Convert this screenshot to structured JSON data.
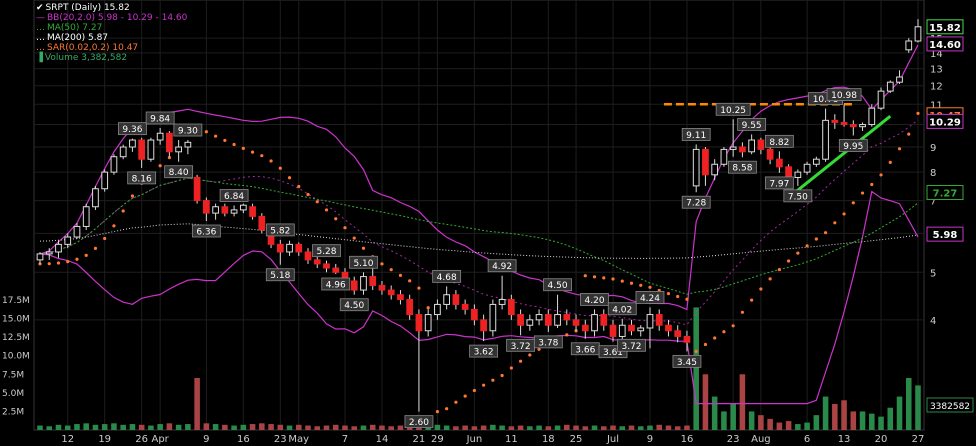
{
  "legend": [
    {
      "text": "SRPT (Daily) 15.82",
      "color": "#ffffff",
      "marker": "check-icon"
    },
    {
      "text": "BB(20,2.0) 5.98 - 10.29 - 14.60",
      "color": "#cc33cc",
      "marker": "line"
    },
    {
      "text": "MA(50) 7.27",
      "color": "#33aa33",
      "marker": "dots"
    },
    {
      "text": "MA(200) 5.87",
      "color": "#ffffff",
      "marker": "dots"
    },
    {
      "text": "SAR(0.02,0.2) 10.47",
      "color": "#ff7733",
      "marker": "dots"
    },
    {
      "text": "Volume 3,382,582",
      "color": "#33aa66",
      "marker": "bars-icon"
    }
  ],
  "colors": {
    "background": "#000000",
    "up": "#44dd44",
    "down": "#ee2222",
    "bollinger": "#cc33cc",
    "ma50": "#33aa33",
    "ma200": "#dddddd",
    "sar": "#ff7733",
    "resistance": "#ff8800",
    "trendline": "#33dd33",
    "volume": "#2a8a4a",
    "volume_down": "#aa4444",
    "grid": "#1e1e1e",
    "tag_bg": "#333333",
    "tag_border": "#888888",
    "tag_text": "#ffffff"
  },
  "chart_data": {
    "type": "candlestick",
    "ticker": "SRPT",
    "period": "Daily",
    "last_price": "15.82",
    "bb_upper_tag": "14.60",
    "bb_mid_tag": "10.29",
    "sar_tag": "10.47",
    "ma50_tag": "7.27",
    "ma200_tag": "5.98",
    "volume_tag": "3382582",
    "y_ticks": [
      4,
      5,
      6,
      7,
      8,
      9,
      10,
      11,
      12,
      13,
      14,
      15
    ],
    "volume_ticks": [
      "2.5M",
      "5.0M",
      "7.5M",
      "10.0M",
      "12.5M",
      "15.0M",
      "17.5M"
    ],
    "x_ticks": [
      "12",
      "19",
      "26",
      "Apr",
      "9",
      "16",
      "23",
      "May",
      "7",
      "14",
      "21",
      "29",
      "Jun",
      "11",
      "18",
      "25",
      "Jul",
      "9",
      "16",
      "23",
      "Aug",
      "6",
      "13",
      "20",
      "27"
    ],
    "candles": [
      {
        "o": 5.3,
        "h": 5.5,
        "l": 5.2,
        "c": 5.45
      },
      {
        "o": 5.45,
        "h": 5.6,
        "l": 5.3,
        "c": 5.5
      },
      {
        "o": 5.5,
        "h": 5.8,
        "l": 5.35,
        "c": 5.7
      },
      {
        "o": 5.7,
        "h": 6.0,
        "l": 5.6,
        "c": 5.9
      },
      {
        "o": 5.9,
        "h": 6.3,
        "l": 5.85,
        "c": 6.2
      },
      {
        "o": 6.2,
        "h": 6.9,
        "l": 6.1,
        "c": 6.8
      },
      {
        "o": 6.8,
        "h": 7.5,
        "l": 6.7,
        "c": 7.4
      },
      {
        "o": 7.4,
        "h": 8.1,
        "l": 7.3,
        "c": 8.0
      },
      {
        "o": 8.0,
        "h": 8.7,
        "l": 7.9,
        "c": 8.6
      },
      {
        "o": 8.6,
        "h": 9.1,
        "l": 8.5,
        "c": 9.0
      },
      {
        "o": 9.0,
        "h": 9.36,
        "l": 8.8,
        "c": 9.3
      },
      {
        "o": 9.3,
        "h": 9.4,
        "l": 8.16,
        "c": 8.5
      },
      {
        "o": 8.5,
        "h": 9.4,
        "l": 8.4,
        "c": 9.3
      },
      {
        "o": 9.3,
        "h": 9.84,
        "l": 9.1,
        "c": 9.6
      },
      {
        "o": 9.6,
        "h": 9.7,
        "l": 8.6,
        "c": 8.8
      },
      {
        "o": 8.8,
        "h": 9.3,
        "l": 8.4,
        "c": 9.0
      },
      {
        "o": 9.0,
        "h": 9.3,
        "l": 8.7,
        "c": 9.2
      },
      {
        "o": 7.8,
        "h": 7.9,
        "l": 6.9,
        "c": 7.0
      },
      {
        "o": 7.0,
        "h": 7.1,
        "l": 6.36,
        "c": 6.6
      },
      {
        "o": 6.6,
        "h": 6.9,
        "l": 6.4,
        "c": 6.8
      },
      {
        "o": 6.8,
        "h": 6.9,
        "l": 6.5,
        "c": 6.6
      },
      {
        "o": 6.6,
        "h": 6.84,
        "l": 6.5,
        "c": 6.7
      },
      {
        "o": 6.7,
        "h": 6.9,
        "l": 6.6,
        "c": 6.85
      },
      {
        "o": 6.8,
        "h": 6.9,
        "l": 6.4,
        "c": 6.5
      },
      {
        "o": 6.5,
        "h": 6.6,
        "l": 6.0,
        "c": 6.1
      },
      {
        "o": 6.1,
        "h": 6.2,
        "l": 5.6,
        "c": 5.7
      },
      {
        "o": 5.7,
        "h": 5.82,
        "l": 5.18,
        "c": 5.5
      },
      {
        "o": 5.5,
        "h": 5.8,
        "l": 5.4,
        "c": 5.7
      },
      {
        "o": 5.7,
        "h": 5.75,
        "l": 5.4,
        "c": 5.5
      },
      {
        "o": 5.5,
        "h": 5.6,
        "l": 5.2,
        "c": 5.3
      },
      {
        "o": 5.3,
        "h": 5.4,
        "l": 5.1,
        "c": 5.2
      },
      {
        "o": 5.2,
        "h": 5.28,
        "l": 5.0,
        "c": 5.1
      },
      {
        "o": 5.1,
        "h": 5.2,
        "l": 4.96,
        "c": 5.0
      },
      {
        "o": 5.0,
        "h": 5.1,
        "l": 4.7,
        "c": 4.8
      },
      {
        "o": 4.8,
        "h": 4.9,
        "l": 4.5,
        "c": 4.6
      },
      {
        "o": 4.6,
        "h": 5.0,
        "l": 4.5,
        "c": 4.9
      },
      {
        "o": 4.9,
        "h": 5.1,
        "l": 4.6,
        "c": 4.7
      },
      {
        "o": 4.7,
        "h": 4.8,
        "l": 4.5,
        "c": 4.6
      },
      {
        "o": 4.6,
        "h": 4.7,
        "l": 4.4,
        "c": 4.5
      },
      {
        "o": 4.5,
        "h": 4.6,
        "l": 4.3,
        "c": 4.4
      },
      {
        "o": 4.4,
        "h": 4.5,
        "l": 4.0,
        "c": 4.1
      },
      {
        "o": 4.1,
        "h": 4.2,
        "l": 2.6,
        "c": 3.8
      },
      {
        "o": 3.8,
        "h": 4.2,
        "l": 3.7,
        "c": 4.1
      },
      {
        "o": 4.1,
        "h": 4.4,
        "l": 4.0,
        "c": 4.3
      },
      {
        "o": 4.3,
        "h": 4.68,
        "l": 4.2,
        "c": 4.5
      },
      {
        "o": 4.5,
        "h": 4.6,
        "l": 4.2,
        "c": 4.3
      },
      {
        "o": 4.3,
        "h": 4.4,
        "l": 4.1,
        "c": 4.2
      },
      {
        "o": 4.2,
        "h": 4.3,
        "l": 3.9,
        "c": 4.0
      },
      {
        "o": 4.0,
        "h": 4.1,
        "l": 3.62,
        "c": 3.8
      },
      {
        "o": 3.8,
        "h": 4.4,
        "l": 3.7,
        "c": 4.3
      },
      {
        "o": 4.3,
        "h": 4.92,
        "l": 4.2,
        "c": 4.4
      },
      {
        "o": 4.4,
        "h": 4.5,
        "l": 4.0,
        "c": 4.1
      },
      {
        "o": 4.1,
        "h": 4.2,
        "l": 3.72,
        "c": 3.9
      },
      {
        "o": 3.9,
        "h": 4.1,
        "l": 3.8,
        "c": 4.0
      },
      {
        "o": 4.0,
        "h": 4.2,
        "l": 3.9,
        "c": 4.1
      },
      {
        "o": 4.1,
        "h": 4.2,
        "l": 3.78,
        "c": 3.9
      },
      {
        "o": 3.9,
        "h": 4.5,
        "l": 3.85,
        "c": 4.1
      },
      {
        "o": 4.1,
        "h": 4.2,
        "l": 3.9,
        "c": 4.0
      },
      {
        "o": 4.0,
        "h": 4.1,
        "l": 3.8,
        "c": 3.9
      },
      {
        "o": 3.9,
        "h": 4.0,
        "l": 3.66,
        "c": 3.8
      },
      {
        "o": 3.8,
        "h": 4.2,
        "l": 3.7,
        "c": 4.1
      },
      {
        "o": 4.1,
        "h": 4.2,
        "l": 3.8,
        "c": 3.9
      },
      {
        "o": 3.9,
        "h": 4.0,
        "l": 3.61,
        "c": 3.7
      },
      {
        "o": 3.7,
        "h": 4.02,
        "l": 3.65,
        "c": 3.9
      },
      {
        "o": 3.9,
        "h": 4.0,
        "l": 3.72,
        "c": 3.8
      },
      {
        "o": 3.8,
        "h": 3.9,
        "l": 3.7,
        "c": 3.85
      },
      {
        "o": 3.85,
        "h": 4.24,
        "l": 3.5,
        "c": 4.1
      },
      {
        "o": 4.1,
        "h": 4.2,
        "l": 3.8,
        "c": 3.9
      },
      {
        "o": 3.9,
        "h": 4.0,
        "l": 3.7,
        "c": 3.8
      },
      {
        "o": 3.8,
        "h": 3.9,
        "l": 3.6,
        "c": 3.7
      },
      {
        "o": 3.7,
        "h": 3.8,
        "l": 3.45,
        "c": 3.6
      },
      {
        "o": 7.5,
        "h": 9.11,
        "l": 7.28,
        "c": 8.9
      },
      {
        "o": 8.9,
        "h": 9.0,
        "l": 7.5,
        "c": 7.9
      },
      {
        "o": 7.9,
        "h": 8.5,
        "l": 7.7,
        "c": 8.3
      },
      {
        "o": 8.3,
        "h": 9.0,
        "l": 8.2,
        "c": 8.9
      },
      {
        "o": 8.9,
        "h": 10.25,
        "l": 8.6,
        "c": 9.0
      },
      {
        "o": 9.0,
        "h": 9.2,
        "l": 8.58,
        "c": 8.8
      },
      {
        "o": 8.8,
        "h": 9.55,
        "l": 8.7,
        "c": 9.3
      },
      {
        "o": 9.3,
        "h": 9.4,
        "l": 8.7,
        "c": 8.9
      },
      {
        "o": 8.9,
        "h": 9.0,
        "l": 8.3,
        "c": 8.5
      },
      {
        "o": 8.5,
        "h": 8.82,
        "l": 7.97,
        "c": 8.2
      },
      {
        "o": 8.2,
        "h": 8.3,
        "l": 7.6,
        "c": 7.8
      },
      {
        "o": 7.8,
        "h": 8.1,
        "l": 7.5,
        "c": 8.0
      },
      {
        "o": 8.0,
        "h": 8.4,
        "l": 7.9,
        "c": 8.3
      },
      {
        "o": 8.3,
        "h": 8.6,
        "l": 8.2,
        "c": 8.5
      },
      {
        "o": 8.5,
        "h": 10.78,
        "l": 8.4,
        "c": 10.2
      },
      {
        "o": 10.2,
        "h": 10.5,
        "l": 9.8,
        "c": 10.1
      },
      {
        "o": 10.1,
        "h": 10.98,
        "l": 9.9,
        "c": 10.0
      },
      {
        "o": 10.0,
        "h": 10.2,
        "l": 9.5,
        "c": 9.9
      },
      {
        "o": 9.9,
        "h": 10.1,
        "l": 9.7,
        "c": 10.0
      },
      {
        "o": 10.0,
        "h": 11.0,
        "l": 9.9,
        "c": 10.8
      },
      {
        "o": 10.8,
        "h": 11.9,
        "l": 10.7,
        "c": 11.7
      },
      {
        "o": 11.7,
        "h": 12.3,
        "l": 11.6,
        "c": 12.2
      },
      {
        "o": 12.2,
        "h": 12.9,
        "l": 12.1,
        "c": 12.5
      },
      {
        "o": 14.2,
        "h": 15.0,
        "l": 14.0,
        "c": 14.8
      },
      {
        "o": 14.8,
        "h": 16.4,
        "l": 14.7,
        "c": 15.82
      }
    ],
    "volume_m": [
      0.6,
      0.5,
      0.7,
      0.6,
      0.8,
      0.9,
      0.7,
      0.8,
      0.9,
      0.7,
      0.8,
      0.7,
      0.6,
      0.8,
      0.9,
      0.7,
      0.8,
      7.0,
      0.9,
      0.8,
      0.7,
      0.6,
      0.7,
      0.8,
      0.9,
      0.8,
      0.7,
      0.6,
      0.7,
      0.6,
      0.5,
      0.6,
      0.7,
      0.6,
      0.5,
      0.6,
      0.7,
      0.6,
      0.5,
      0.6,
      0.7,
      0.9,
      0.8,
      0.7,
      0.6,
      0.5,
      0.6,
      0.5,
      0.6,
      0.7,
      0.6,
      0.5,
      0.6,
      0.5,
      0.6,
      0.5,
      0.6,
      0.7,
      0.6,
      0.5,
      0.6,
      0.5,
      0.6,
      0.5,
      0.6,
      0.5,
      0.6,
      0.7,
      0.6,
      0.5,
      0.6,
      16.5,
      7.5,
      4.5,
      2.5,
      3.5,
      7.5,
      2.5,
      2.0,
      1.5,
      1.0,
      1.2,
      0.8,
      1.0,
      2.0,
      4.5,
      3.5,
      4.0,
      2.5,
      2.5,
      2.2,
      1.8,
      3.0,
      4.5,
      7.0,
      6.0
    ],
    "labels_high": [
      {
        "i": 10,
        "v": "9.36"
      },
      {
        "i": 13,
        "v": "9.84"
      },
      {
        "i": 16,
        "v": "9.30"
      },
      {
        "i": 21,
        "v": "6.84"
      },
      {
        "i": 26,
        "v": "5.82"
      },
      {
        "i": 31,
        "v": "5.28"
      },
      {
        "i": 35,
        "v": "5.10"
      },
      {
        "i": 44,
        "v": "4.68"
      },
      {
        "i": 50,
        "v": "4.92"
      },
      {
        "i": 56,
        "v": "4.50"
      },
      {
        "i": 60,
        "v": "4.20"
      },
      {
        "i": 63,
        "v": "4.02"
      },
      {
        "i": 66,
        "v": "4.24"
      },
      {
        "i": 71,
        "v": "9.11"
      },
      {
        "i": 75,
        "v": "10.25"
      },
      {
        "i": 77,
        "v": "9.55"
      },
      {
        "i": 80,
        "v": "8.82"
      },
      {
        "i": 85,
        "v": "10.78"
      },
      {
        "i": 87,
        "v": "10.98"
      }
    ],
    "labels_low": [
      {
        "i": 11,
        "v": "8.16"
      },
      {
        "i": 15,
        "v": "8.40"
      },
      {
        "i": 18,
        "v": "6.36"
      },
      {
        "i": 26,
        "v": "5.18"
      },
      {
        "i": 32,
        "v": "4.96"
      },
      {
        "i": 34,
        "v": "4.50"
      },
      {
        "i": 41,
        "v": "2.60"
      },
      {
        "i": 48,
        "v": "3.62"
      },
      {
        "i": 52,
        "v": "3.72"
      },
      {
        "i": 55,
        "v": "3.78"
      },
      {
        "i": 59,
        "v": "3.66"
      },
      {
        "i": 62,
        "v": "3.61"
      },
      {
        "i": 64,
        "v": "3.72"
      },
      {
        "i": 70,
        "v": "3.45"
      },
      {
        "i": 71,
        "v": "7.28"
      },
      {
        "i": 76,
        "v": "8.58"
      },
      {
        "i": 80,
        "v": "7.97"
      },
      {
        "i": 82,
        "v": "7.50"
      },
      {
        "i": 88,
        "v": "9.95"
      }
    ],
    "resistance_level": 11.0,
    "y_scale": "log"
  }
}
